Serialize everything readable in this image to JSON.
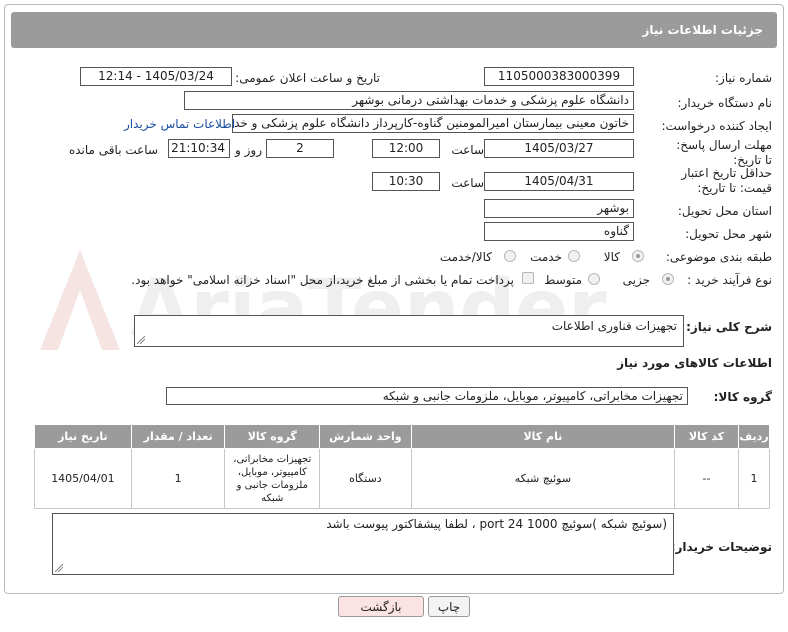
{
  "header": {
    "title": "جزئیات اطلاعات نیاز"
  },
  "fields": {
    "need_number_label": "شماره نیاز:",
    "need_number": "1105000383000399",
    "announce_label": "تاریخ و ساعت اعلان عمومی:",
    "announce_value": "1405/03/24 - 12:14",
    "buyer_org_label": "نام دستگاه خریدار:",
    "buyer_org": "دانشگاه علوم پزشکی و خدمات بهداشتی درمانی بوشهر",
    "creator_label": "ایجاد کننده درخواست:",
    "creator": "خاتون معینی بیمارستان امیرالمومنین گناوه-کارپرداز دانشگاه علوم پزشکی و خدم",
    "contact_link": "اطلاعات تماس خریدار",
    "deadline_label": "مهلت ارسال پاسخ: تا تاریخ:",
    "deadline_date": "1405/03/27",
    "hour_label": "ساعت",
    "deadline_time": "12:00",
    "days_value": "2",
    "days_label": "روز و",
    "remaining_time": "21:10:34",
    "remaining_label": "ساعت باقی مانده",
    "min_price_label": "حداقل تاریخ اعتبار قیمت: تا تاریخ:",
    "min_price_date": "1405/04/31",
    "min_price_time": "10:30",
    "province_label": "استان محل تحویل:",
    "province": "بوشهر",
    "city_label": "شهر محل تحویل:",
    "city": "گناوه",
    "category_label": "طبقه بندی موضوعی:",
    "category_options": [
      "کالا",
      "خدمت",
      "کالا/خدمت"
    ],
    "process_label": "نوع فرآیند خرید :",
    "process_options": [
      "جزیی",
      "متوسط"
    ],
    "payment_note": "پرداخت تمام یا بخشی از مبلغ خرید،از محل \"اسناد خزانه اسلامی\" خواهد بود."
  },
  "summary": {
    "label": "شرح کلی نیاز:",
    "value": "تجهیزات فناوری اطلاعات"
  },
  "goods_section": {
    "title": "اطلاعات کالاهای مورد نیاز"
  },
  "goods_group": {
    "label": "گروه کالا:",
    "value": "تجهیزات مخابراتی، کامپیوتر، موبایل، ملزومات جانبی و شبکه"
  },
  "table": {
    "headers": [
      "ردیف",
      "کد کالا",
      "نام کالا",
      "واحد شمارش",
      "گروه کالا",
      "تعداد / مقدار",
      "تاریخ نیاز"
    ],
    "rows": [
      {
        "row": "1",
        "code": "--",
        "name": "سوئیچ شبکه",
        "unit": "دستگاه",
        "group": "تجهیزات مخابراتی، کامپیوتر، موبایل، ملزومات جانبی و شبکه",
        "qty": "1",
        "date": "1405/04/01"
      }
    ]
  },
  "buyer_notes": {
    "label": "توضیحات خریدار:",
    "value": "(سوئیچ شبکه )سوئیچ 1000   port 24  ، لطفا پیشفاکتور پیوست باشد"
  },
  "buttons": {
    "print": "چاپ",
    "back": "بازگشت"
  },
  "watermark": {
    "text": "AriaTender.neT"
  }
}
